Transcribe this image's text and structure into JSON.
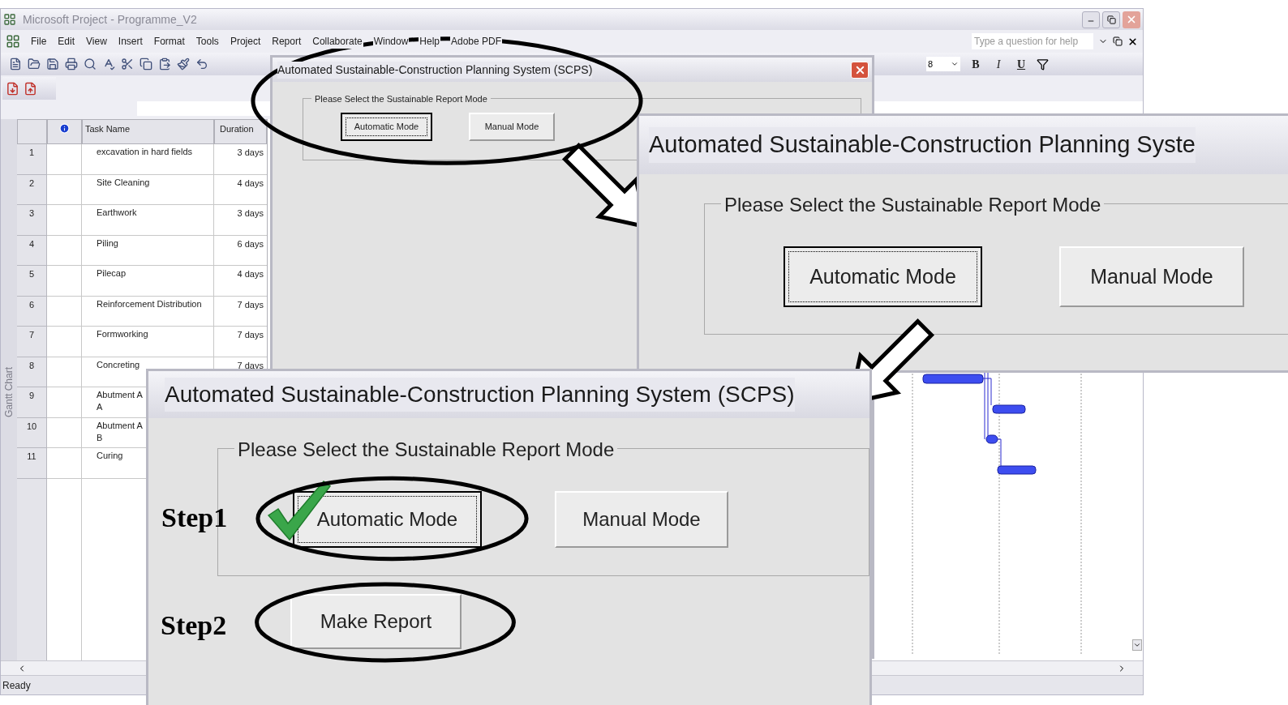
{
  "app": {
    "title": "Microsoft Project - Programme_V2",
    "menu": [
      "File",
      "Edit",
      "View",
      "Insert",
      "Format",
      "Tools",
      "Project",
      "Report",
      "Collaborate",
      "Window",
      "Help",
      "Adobe PDF"
    ],
    "help_placeholder": "Type a question for help",
    "font_size": "8",
    "format_buttons": [
      "B",
      "I",
      "U"
    ],
    "view_bar_label": "Gantt Chart",
    "status": "Ready"
  },
  "table": {
    "columns": [
      "Task Name",
      "Duration"
    ],
    "rows": [
      {
        "id": "1",
        "name": "excavation in hard fields",
        "duration": "3 days"
      },
      {
        "id": "2",
        "name": "Site Cleaning",
        "duration": "4 days"
      },
      {
        "id": "3",
        "name": "Earthwork",
        "duration": "3 days"
      },
      {
        "id": "4",
        "name": "Piling",
        "duration": "6 days"
      },
      {
        "id": "5",
        "name": "Pilecap",
        "duration": "4 days"
      },
      {
        "id": "6",
        "name": "Reinforcement Distribution",
        "duration": "7 days"
      },
      {
        "id": "7",
        "name": "Formworking",
        "duration": "7 days"
      },
      {
        "id": "8",
        "name": "Concreting",
        "duration": "7 days"
      },
      {
        "id": "9",
        "name": "Abutment A",
        "name_line2": "A"
      },
      {
        "id": "10",
        "name": "Abutment A",
        "name_line2": "B"
      },
      {
        "id": "11",
        "name": "Curing"
      }
    ]
  },
  "dialogs": [
    {
      "kind": "small",
      "title": "Automated Sustainable-Construction Planning System (SCPS)",
      "circled": true,
      "group_label": "Please Select the Sustainable Report Mode",
      "buttons": [
        {
          "label": "Automatic Mode",
          "focused": true,
          "ticked": false,
          "circled": false
        },
        {
          "label": "Manual Mode",
          "focused": false,
          "ticked": false,
          "circled": false
        }
      ]
    },
    {
      "kind": "zoom",
      "title": "Automated Sustainable-Construction Planning Syste",
      "circled": false,
      "group_label": "Please Select the Sustainable Report Mode",
      "buttons": [
        {
          "label": "Automatic Mode",
          "focused": true,
          "ticked": false,
          "circled": false
        },
        {
          "label": "Manual Mode",
          "focused": false,
          "ticked": false,
          "circled": false
        }
      ]
    },
    {
      "kind": "steps",
      "title": "Automated Sustainable-Construction Planning System (SCPS)",
      "circled": false,
      "group_label": "Please Select the Sustainable Report Mode",
      "buttons": [
        {
          "label": "Automatic Mode",
          "focused": true,
          "ticked": true,
          "circled": true
        },
        {
          "label": "Manual Mode",
          "focused": false,
          "ticked": false,
          "circled": false
        }
      ],
      "action": {
        "label": "Make Report",
        "circled": true
      },
      "steps": [
        "Step1",
        "Step2"
      ]
    }
  ]
}
